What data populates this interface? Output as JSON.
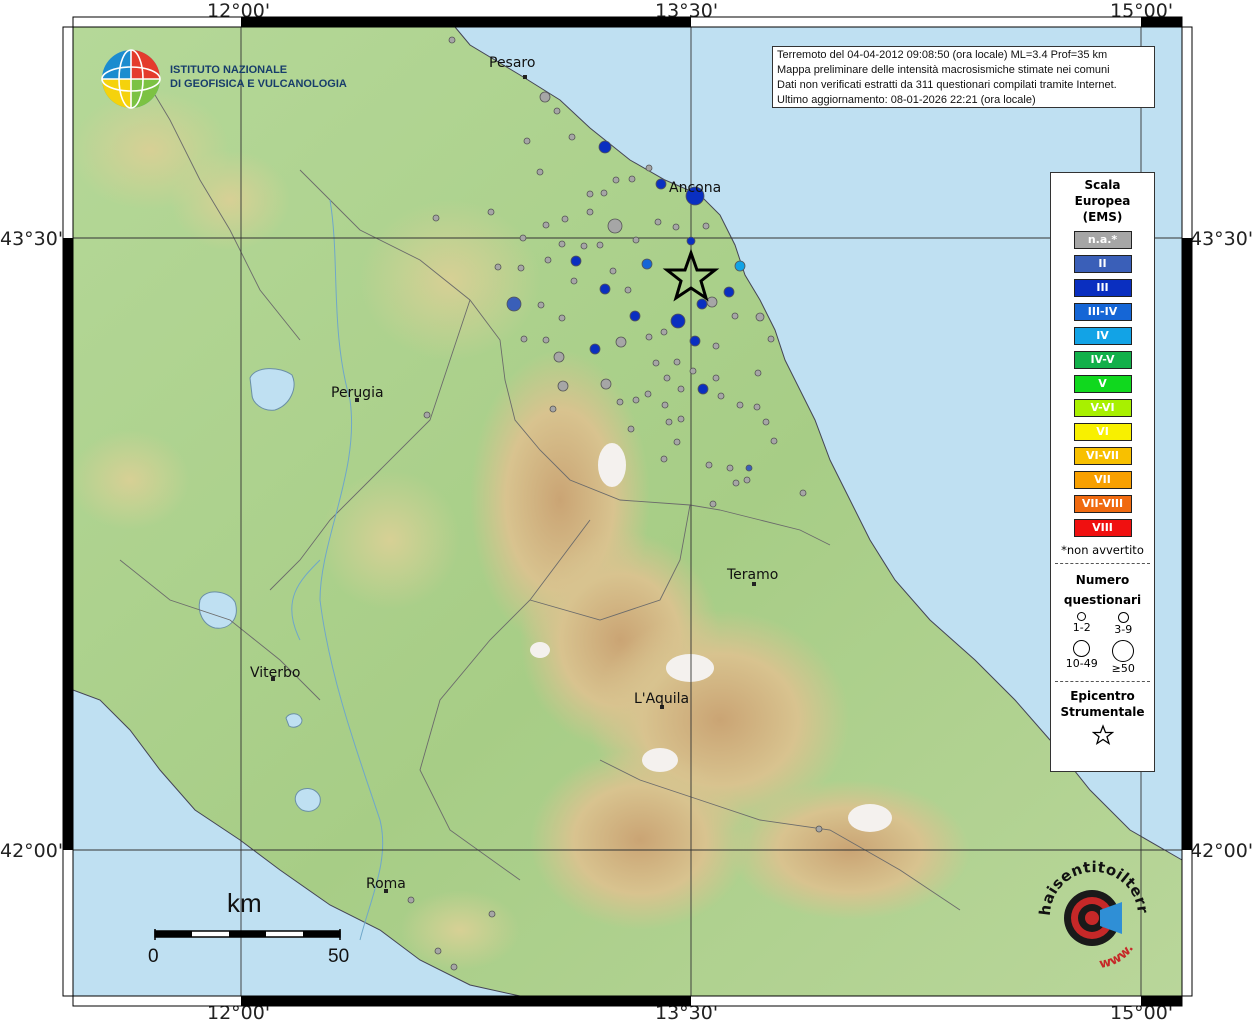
{
  "axes": {
    "top_ticks": [
      "12°00'",
      "13°30'",
      "15°00'"
    ],
    "bottom_ticks": [
      "12°00'",
      "13°30'",
      "15°00'"
    ],
    "left_ticks": [
      "43°30'",
      "42°00'"
    ],
    "right_ticks": [
      "43°30'",
      "42°00'"
    ]
  },
  "info": {
    "line1": "Terremoto del 04-04-2012 09:08:50 (ora locale) ML=3.4 Prof=35 km",
    "line2": "Mappa preliminare delle intensità macrosismiche stimate nei comuni",
    "line3": "Dati non verificati estratti da 311 questionari compilati tramite Internet.",
    "line4": "Ultimo aggiornamento: 08-01-2026 22:21 (ora locale)"
  },
  "logo": {
    "line1": "ISTITUTO NAZIONALE",
    "line2": "DI GEOFISICA E VULCANOLOGIA"
  },
  "legend": {
    "title_lines": [
      "Scala",
      "Europea",
      "(EMS)"
    ],
    "ems_classes": [
      {
        "label": "n.a.*",
        "color": "#a6a6a6"
      },
      {
        "label": "II",
        "color": "#3a5fb8"
      },
      {
        "label": "III",
        "color": "#0a2fc0"
      },
      {
        "label": "III-IV",
        "color": "#1566d6"
      },
      {
        "label": "IV",
        "color": "#12a3e6"
      },
      {
        "label": "IV-V",
        "color": "#12b04a"
      },
      {
        "label": "V",
        "color": "#10d81e"
      },
      {
        "label": "V-VI",
        "color": "#a8f000"
      },
      {
        "label": "VI",
        "color": "#f8f000"
      },
      {
        "label": "VI-VII",
        "color": "#f8c000"
      },
      {
        "label": "VII",
        "color": "#f8a000"
      },
      {
        "label": "VII-VIII",
        "color": "#f06a10"
      },
      {
        "label": "VIII",
        "color": "#f01010"
      }
    ],
    "na_note": "*non avvertito",
    "count_title_lines": [
      "Numero",
      "questionari"
    ],
    "count_classes": [
      "1-2",
      "3-9",
      "10-49",
      "≥50"
    ],
    "epicenter_lines": [
      "Epicentro",
      "Strumentale"
    ]
  },
  "places": {
    "pesaro": "Pesaro",
    "ancona": "Ancona",
    "perugia": "Perugia",
    "teramo": "Teramo",
    "viterbo": "Viterbo",
    "laquila": "L'Aquila",
    "roma": "Roma"
  },
  "scale": {
    "unit": "km",
    "min": "0",
    "max": "50"
  },
  "hst_logo": {
    "text": "haisentitoilterremoto.it",
    "prefix": "www."
  },
  "colors": {
    "sea": "#bfe0f2",
    "land_low": "#a9d28a",
    "land_mid": "#d9d09a",
    "land_high": "#c49f6e",
    "snow": "#f4f1ee"
  }
}
